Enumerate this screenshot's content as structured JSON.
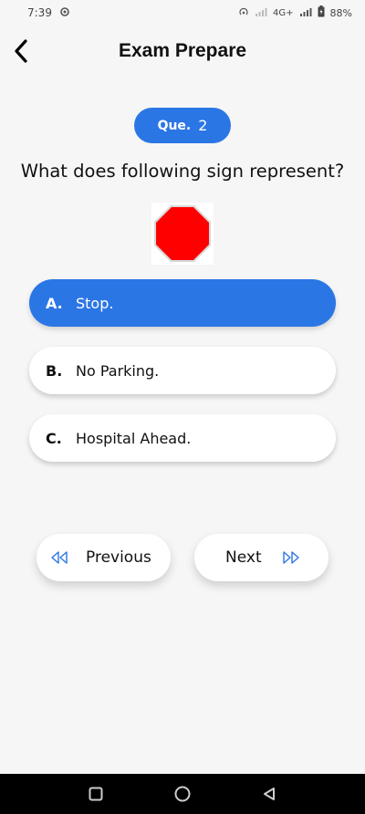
{
  "status_bar": {
    "time": "7:39",
    "network": "4G+",
    "battery": "88%"
  },
  "app_bar": {
    "title": "Exam Prepare"
  },
  "question": {
    "label": "Que.",
    "number": "2",
    "text": "What does following sign represent?",
    "sign_icon": "stop-sign-octagon"
  },
  "options": [
    {
      "letter": "A.",
      "text": "Stop.",
      "selected": true
    },
    {
      "letter": "B.",
      "text": "No Parking.",
      "selected": false
    },
    {
      "letter": "C.",
      "text": "Hospital Ahead.",
      "selected": false
    }
  ],
  "navigation": {
    "previous_label": "Previous",
    "next_label": "Next"
  },
  "colors": {
    "accent": "#2b76e5",
    "sign_red": "#ff0000",
    "nav_icon": "#2b76e5"
  }
}
